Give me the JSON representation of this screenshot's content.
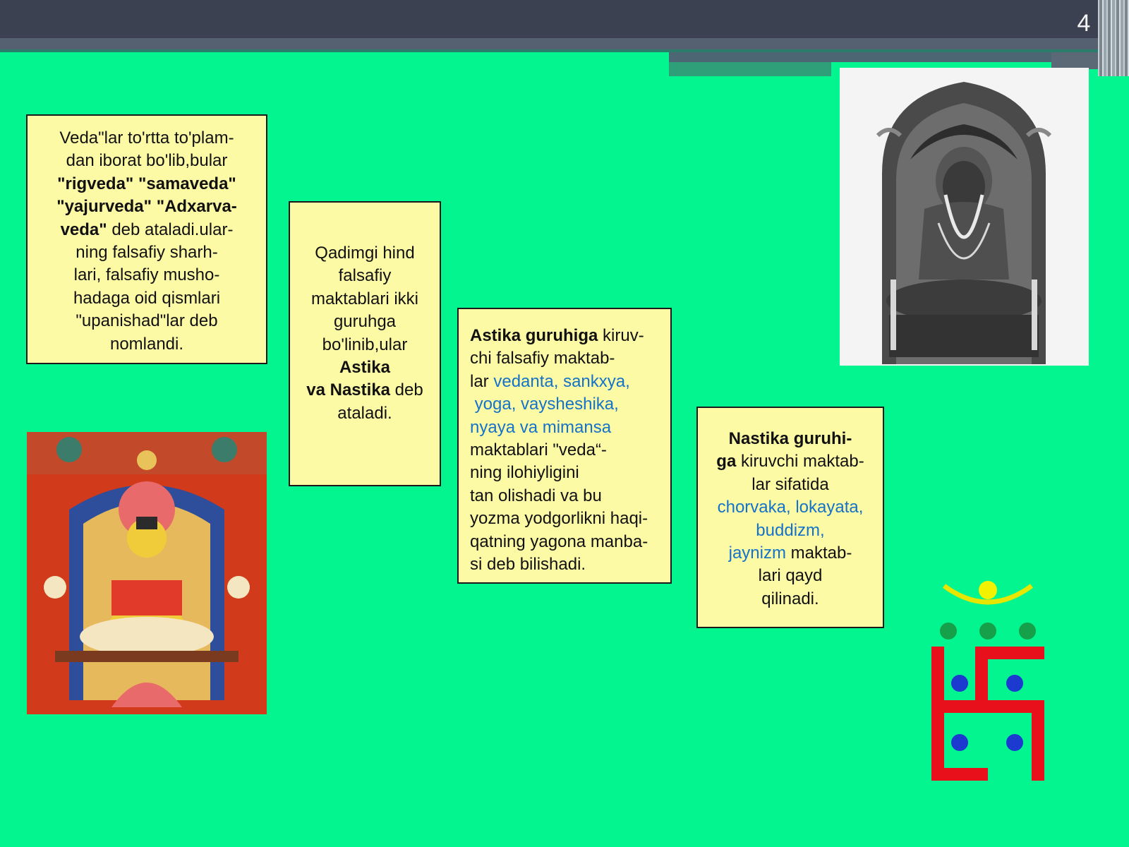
{
  "slide": {
    "page_number": "4"
  },
  "box1": {
    "t1": "Veda\"lar to'rtta to'plam-",
    "t2": "dan iborat bo'lib,bular",
    "t3": "\"rigveda\" \"samaveda\"",
    "t4": "\"yajurveda\" \"Adxarva-",
    "t5": "veda\"",
    "t6": " deb ataladi.ular-",
    "t7": "ning falsafiy sharh-",
    "t8": "lari, falsafiy musho-",
    "t9": "hadaga oid qismlari",
    "t10": "\"upanishad\"lar deb",
    "t11": "nomlandi."
  },
  "box2": {
    "t1": "Qadimgi hind",
    "t2": "falsafiy",
    "t3": "maktablari ikki",
    "t4": "guruhga",
    "t5": "bo'linib,ular",
    "t6": "Astika",
    "t7": "va Nastika",
    "t8": " deb",
    "t9": "ataladi."
  },
  "box3": {
    "t1": "Astika guruhiga",
    "t2": " kiruv-",
    "t3": "chi falsafiy maktab-",
    "t4": "lar ",
    "t5": "vedanta, sankxya,",
    "t6": " yoga, vaysheshika,",
    "t7": "nyaya va mimansa",
    "t8": "maktablari \"veda“-",
    "t9": "ning ilohiyligini",
    "t10": "tan olishadi va bu",
    "t11": "yozma yodgorlikni haqi-",
    "t12": "qatning yagona manba-",
    "t13": "si deb bilishadi."
  },
  "box4": {
    "t1": "Nastika guruhi-",
    "t2": "ga",
    "t3": " kiruvchi maktab-",
    "t4": "lar sifatida",
    "t5": "chorvaka, lokayata,",
    "t6": "buddizm,",
    "t7": "jaynizm",
    "t8": " maktab-",
    "t9": "lari qayd",
    "t10": "qilinadi."
  },
  "colors": {
    "background": "#03f590",
    "box_fill": "#fdfaa6",
    "link_blue": "#1473c8",
    "header": "#3b4150"
  }
}
